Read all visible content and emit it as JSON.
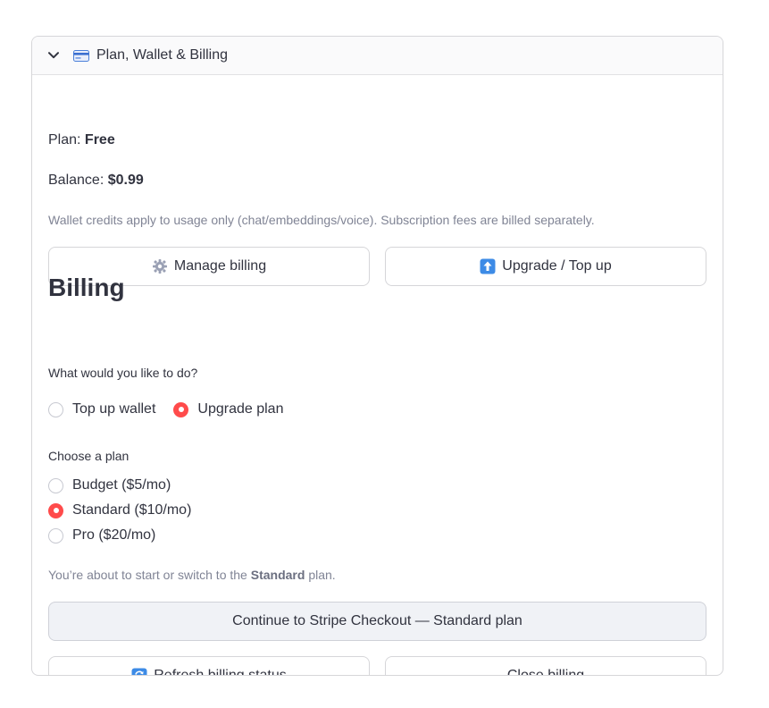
{
  "expander": {
    "title": "Plan, Wallet & Billing",
    "icon": "credit-card-icon"
  },
  "summary": {
    "plan_label": "Plan:",
    "plan_value": "Free",
    "balance_label": "Balance:",
    "balance_value": "$0.99",
    "note": "Wallet credits apply to usage only (chat/embeddings/voice). Subscription fees are billed separately."
  },
  "actions": {
    "manage_billing": "Manage billing",
    "upgrade_topup": "Upgrade / Top up"
  },
  "billing": {
    "heading": "Billing",
    "action_question": "What would you like to do?",
    "action_options": [
      "Top up wallet",
      "Upgrade plan"
    ],
    "action_selected": "Upgrade plan",
    "plan_question": "Choose a plan",
    "plan_options": [
      "Budget ($5/mo)",
      "Standard ($10/mo)",
      "Pro ($20/mo)"
    ],
    "plan_selected": "Standard ($10/mo)",
    "notice_prefix": "You’re about to start or switch to the",
    "notice_plan": "Standard",
    "notice_suffix": "plan.",
    "checkout_button": "Continue to Stripe Checkout — Standard plan",
    "refresh_button": "Refresh billing status",
    "close_button": "Close billing"
  },
  "colors": {
    "accent": "#ff4b4b",
    "border": "#d6d6d9",
    "muted_text": "#808495",
    "text": "#31333f"
  }
}
